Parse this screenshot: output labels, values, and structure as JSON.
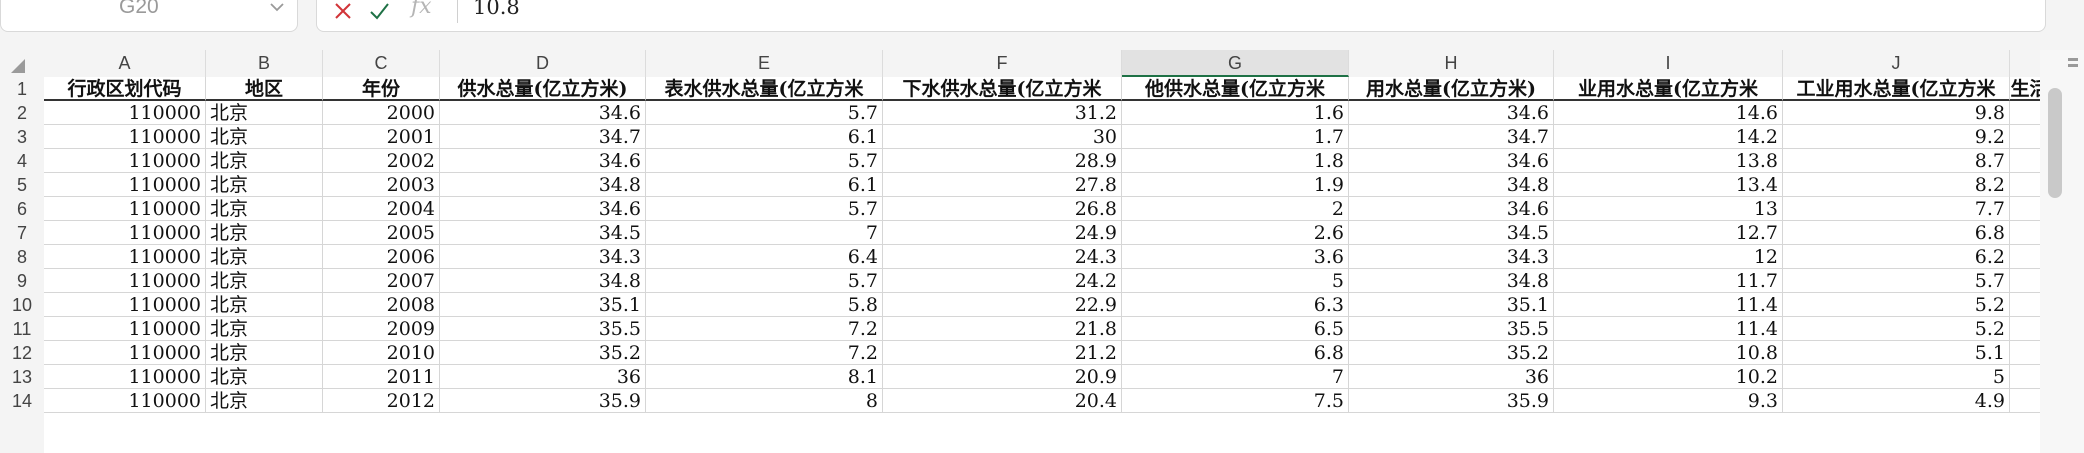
{
  "namebox": {
    "ref": "G20"
  },
  "formula_bar": {
    "fx_label": "fx",
    "value": "10.8"
  },
  "columns": [
    "A",
    "B",
    "C",
    "D",
    "E",
    "F",
    "G",
    "H",
    "I",
    "J"
  ],
  "selected_column": "G",
  "row_numbers": [
    "1",
    "2",
    "3",
    "4",
    "5",
    "6",
    "7",
    "8",
    "9",
    "10",
    "11",
    "12",
    "13",
    "14"
  ],
  "headers": [
    "行政区划代码",
    "地区",
    "年份",
    "供水总量(亿立方米)",
    "表水供水总量(亿立方米",
    "下水供水总量(亿立方米",
    "他供水总量(亿立方米",
    "用水总量(亿立方米)",
    "业用水总量(亿立方米",
    "工业用水总量(亿立方米",
    "生活"
  ],
  "rows": [
    [
      "110000",
      "北京",
      "2000",
      "34.6",
      "5.7",
      "31.2",
      "1.6",
      "34.6",
      "14.6",
      "9.8"
    ],
    [
      "110000",
      "北京",
      "2001",
      "34.7",
      "6.1",
      "30",
      "1.7",
      "34.7",
      "14.2",
      "9.2"
    ],
    [
      "110000",
      "北京",
      "2002",
      "34.6",
      "5.7",
      "28.9",
      "1.8",
      "34.6",
      "13.8",
      "8.7"
    ],
    [
      "110000",
      "北京",
      "2003",
      "34.8",
      "6.1",
      "27.8",
      "1.9",
      "34.8",
      "13.4",
      "8.2"
    ],
    [
      "110000",
      "北京",
      "2004",
      "34.6",
      "5.7",
      "26.8",
      "2",
      "34.6",
      "13",
      "7.7"
    ],
    [
      "110000",
      "北京",
      "2005",
      "34.5",
      "7",
      "24.9",
      "2.6",
      "34.5",
      "12.7",
      "6.8"
    ],
    [
      "110000",
      "北京",
      "2006",
      "34.3",
      "6.4",
      "24.3",
      "3.6",
      "34.3",
      "12",
      "6.2"
    ],
    [
      "110000",
      "北京",
      "2007",
      "34.8",
      "5.7",
      "24.2",
      "5",
      "34.8",
      "11.7",
      "5.7"
    ],
    [
      "110000",
      "北京",
      "2008",
      "35.1",
      "5.8",
      "22.9",
      "6.3",
      "35.1",
      "11.4",
      "5.2"
    ],
    [
      "110000",
      "北京",
      "2009",
      "35.5",
      "7.2",
      "21.8",
      "6.5",
      "35.5",
      "11.4",
      "5.2"
    ],
    [
      "110000",
      "北京",
      "2010",
      "35.2",
      "7.2",
      "21.2",
      "6.8",
      "35.2",
      "10.8",
      "5.1"
    ],
    [
      "110000",
      "北京",
      "2011",
      "36",
      "8.1",
      "20.9",
      "7",
      "36",
      "10.2",
      "5"
    ],
    [
      "110000",
      "北京",
      "2012",
      "35.9",
      "8",
      "20.4",
      "7.5",
      "35.9",
      "9.3",
      "4.9"
    ]
  ],
  "colors": {
    "selected_header_underline": "#1e7145",
    "check_icon": "#1e7145",
    "cancel_icon": "#d13438"
  }
}
